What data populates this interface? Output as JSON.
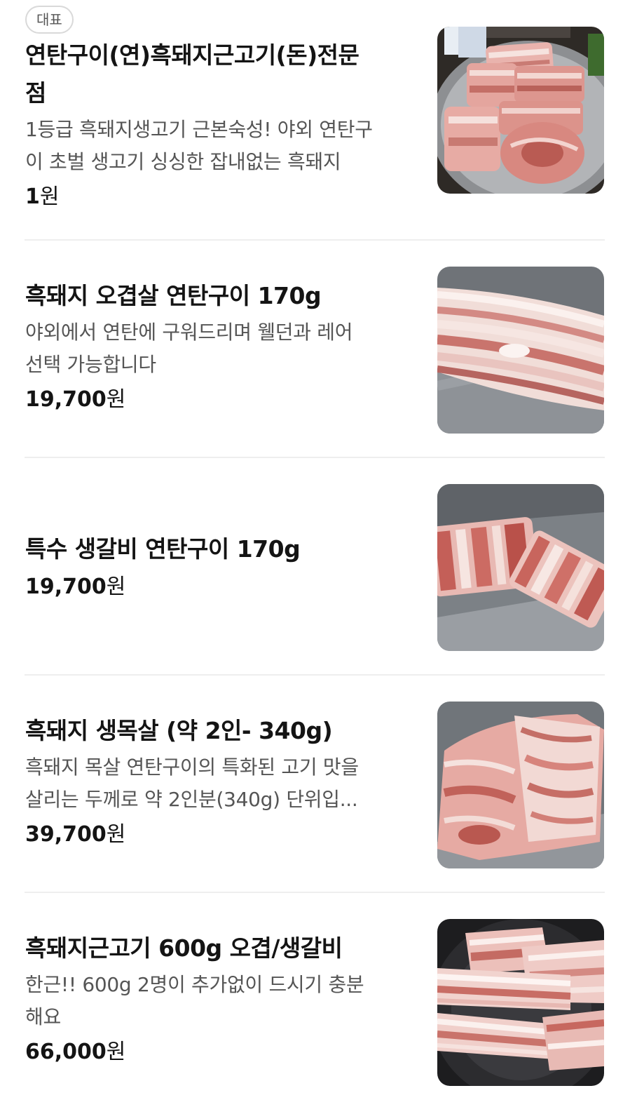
{
  "menu": {
    "items": [
      {
        "badge": "대표",
        "name_lines": [
          "연탄구이(연)흑돼지근고기(돈)전문",
          "점"
        ],
        "desc_lines": [
          "1등급 흑돼지생고기 근본숙성! 야외 연탄구",
          "이 초벌 생고기 싱싱한 잡내없는 흑돼지"
        ],
        "price": "1",
        "currency": "원",
        "image": "grilled-pork-platter-photo"
      },
      {
        "name_lines": [
          "흑돼지 오겹살 연탄구이 170g"
        ],
        "desc_lines": [
          "야외에서 연탄에 구워드리며 웰던과 레어",
          "선택 가능합니다"
        ],
        "price": "19,700",
        "currency": "원",
        "image": "pork-belly-slab-photo"
      },
      {
        "name_lines": [
          "특수 생갈비 연탄구이 170g"
        ],
        "desc_lines": [],
        "price": "19,700",
        "currency": "원",
        "image": "pork-rib-strips-photo"
      },
      {
        "name_lines": [
          "흑돼지 생목살 (약 2인- 340g)"
        ],
        "desc_lines": [
          "흑돼지 목살 연탄구이의 특화된 고기 맛을",
          "살리는 두께로 약 2인분(340g) 단위입..."
        ],
        "price": "39,700",
        "currency": "원",
        "image": "pork-neck-chunk-photo"
      },
      {
        "name_lines": [
          "흑돼지근고기 600g 오겹/생갈비"
        ],
        "desc_lines": [
          "한근!! 600g 2명이 추가없이 드시기 충분",
          "해요"
        ],
        "price": "66,000",
        "currency": "원",
        "image": "pork-on-grill-photo"
      }
    ]
  },
  "colors": {
    "text_primary": "#141414",
    "text_secondary": "#555555",
    "divider": "#eeeeee",
    "badge_border": "#d9d9d9"
  }
}
